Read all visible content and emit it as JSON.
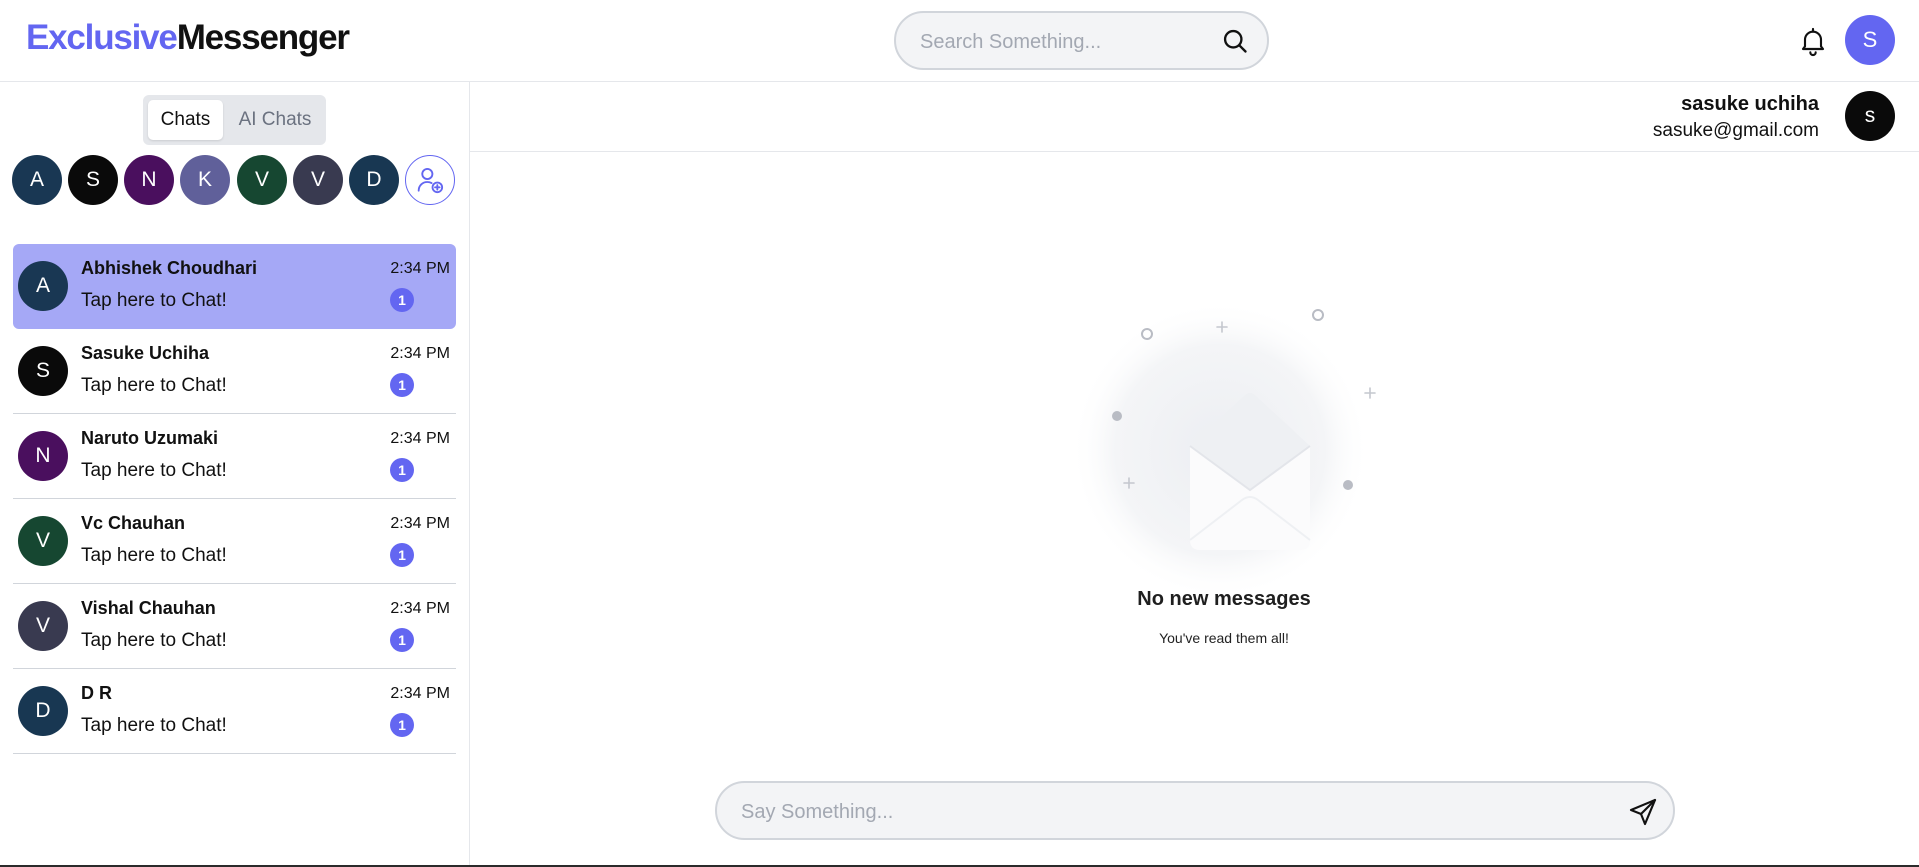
{
  "header": {
    "brand_part1": "Exclusive",
    "brand_part2": "Messenger",
    "search_placeholder": "Search Something...",
    "user_initial": "S",
    "icons": {
      "search": "search-icon",
      "notifications": "bell-icon"
    }
  },
  "sidebar": {
    "tabs": [
      {
        "label": "Chats",
        "active": true
      },
      {
        "label": "AI Chats",
        "active": false
      }
    ],
    "stories": [
      {
        "initial": "A",
        "color": "#193753"
      },
      {
        "initial": "S",
        "color": "#0a0a0a"
      },
      {
        "initial": "N",
        "color": "#4a0f5e"
      },
      {
        "initial": "K",
        "color": "#60609a"
      },
      {
        "initial": "V",
        "color": "#164731"
      },
      {
        "initial": "V",
        "color": "#393a50"
      },
      {
        "initial": "D",
        "color": "#183752"
      }
    ],
    "add_contact_icon": "add-user-icon",
    "chats": [
      {
        "initial": "A",
        "color": "#193753",
        "name": "Abhishek Choudhari",
        "message": "Tap here to Chat!",
        "time": "2:34 PM",
        "unread": "1",
        "active": true
      },
      {
        "initial": "S",
        "color": "#0a0a0a",
        "name": "Sasuke Uchiha",
        "message": "Tap here to Chat!",
        "time": "2:34 PM",
        "unread": "1",
        "active": false
      },
      {
        "initial": "N",
        "color": "#4a0f5e",
        "name": "Naruto Uzumaki",
        "message": "Tap here to Chat!",
        "time": "2:34 PM",
        "unread": "1",
        "active": false
      },
      {
        "initial": "V",
        "color": "#164731",
        "name": "Vc Chauhan",
        "message": "Tap here to Chat!",
        "time": "2:34 PM",
        "unread": "1",
        "active": false
      },
      {
        "initial": "V",
        "color": "#393a50",
        "name": "Vishal Chauhan",
        "message": "Tap here to Chat!",
        "time": "2:34 PM",
        "unread": "1",
        "active": false
      },
      {
        "initial": "D",
        "color": "#183752",
        "name": "D R",
        "message": "Tap here to Chat!",
        "time": "2:34 PM",
        "unread": "1",
        "active": false
      }
    ]
  },
  "conversation": {
    "user_name": "sasuke uchiha",
    "user_email": "sasuke@gmail.com",
    "user_initial": "s",
    "empty_title": "No new messages",
    "empty_subtitle": "You've read them all!",
    "empty_icon": "open-envelope-icon",
    "input_placeholder": "Say Something...",
    "send_icon": "send-icon"
  },
  "colors": {
    "accent": "#6366f1",
    "active_chat_bg": "#a5a8f6",
    "border": "#e5e7eb"
  }
}
